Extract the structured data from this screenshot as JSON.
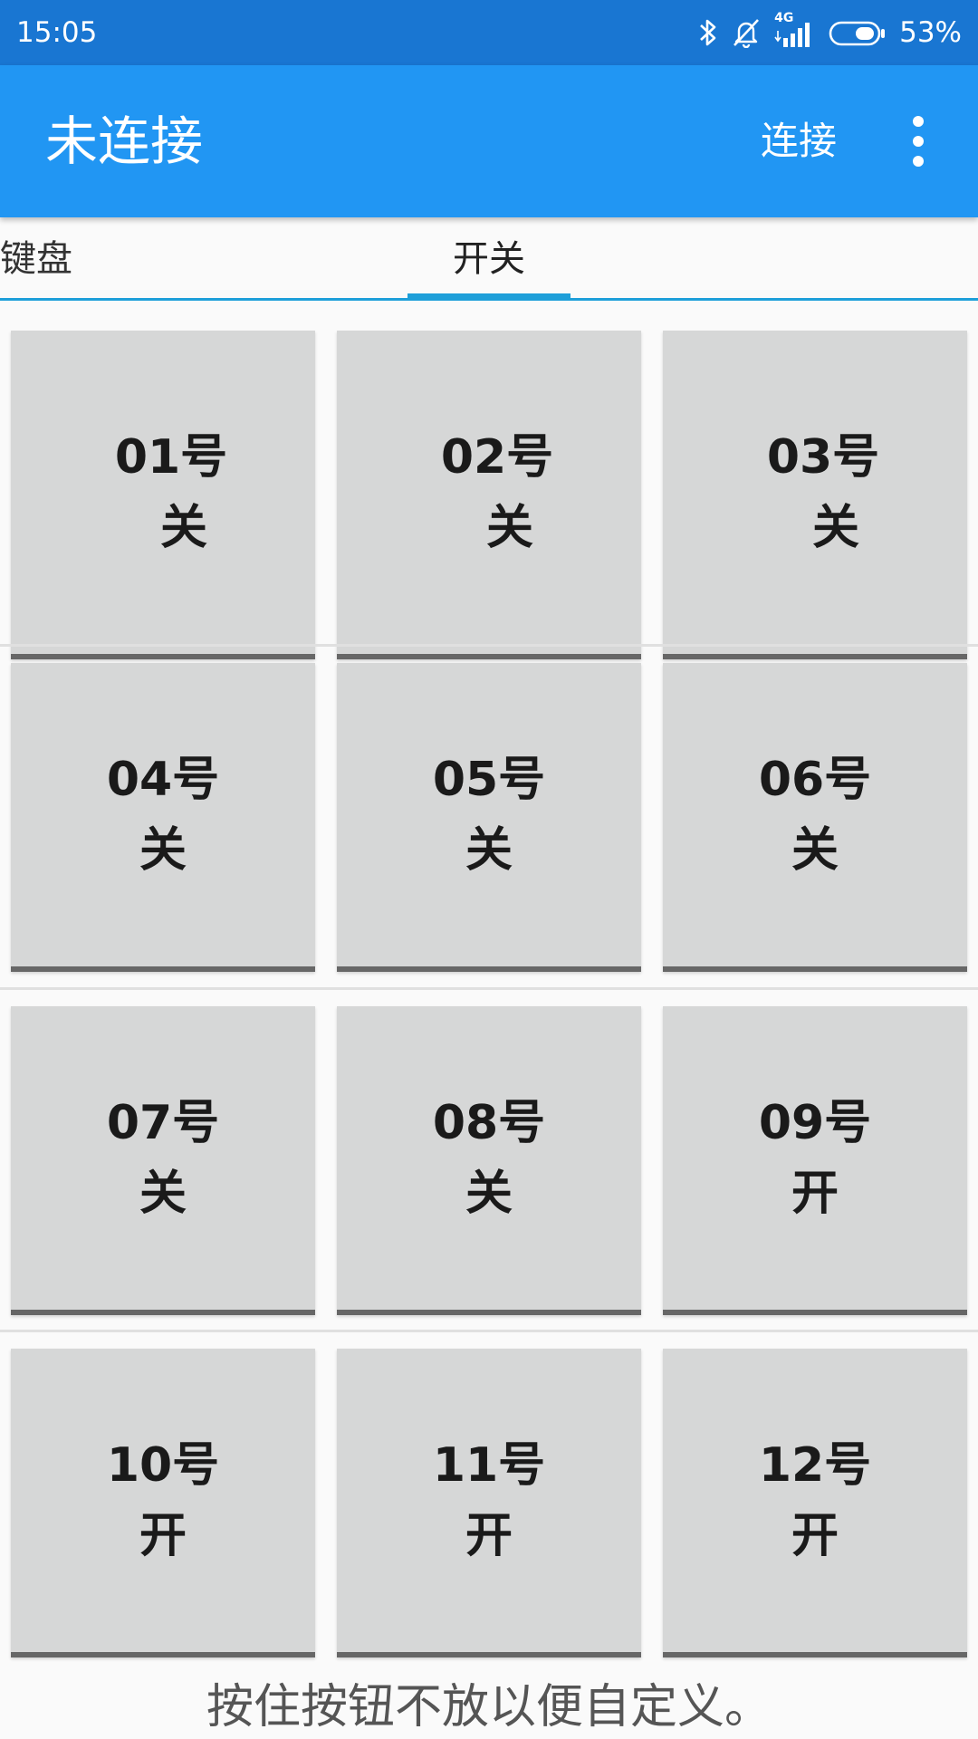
{
  "status_bar": {
    "time": "15:05",
    "network": "4G",
    "battery": "53%",
    "icons": [
      "bluetooth-icon",
      "bell-off-icon",
      "signal-icon",
      "battery-icon"
    ]
  },
  "app_bar": {
    "title": "未连接",
    "action_connect": "连接",
    "overflow_icon": "more-vert-icon"
  },
  "tabs": [
    {
      "label": "键盘",
      "selected": false
    },
    {
      "label": "开关",
      "selected": true
    }
  ],
  "switches": [
    {
      "number": "01号",
      "state": "关"
    },
    {
      "number": "02号",
      "state": "关"
    },
    {
      "number": "03号",
      "state": "关"
    },
    {
      "number": "04号",
      "state": "关"
    },
    {
      "number": "05号",
      "state": "关"
    },
    {
      "number": "06号",
      "state": "关"
    },
    {
      "number": "07号",
      "state": "关"
    },
    {
      "number": "08号",
      "state": "关"
    },
    {
      "number": "09号",
      "state": "开"
    },
    {
      "number": "10号",
      "state": "开"
    },
    {
      "number": "11号",
      "state": "开"
    },
    {
      "number": "12号",
      "state": "开"
    }
  ],
  "hint": "按住按钮不放以便自定义。",
  "colors": {
    "status_bar": "#1976d2",
    "app_bar": "#2196f3",
    "tab_indicator": "#1e9fd9",
    "button_bg": "#d6d7d7",
    "button_border": "#676767"
  }
}
